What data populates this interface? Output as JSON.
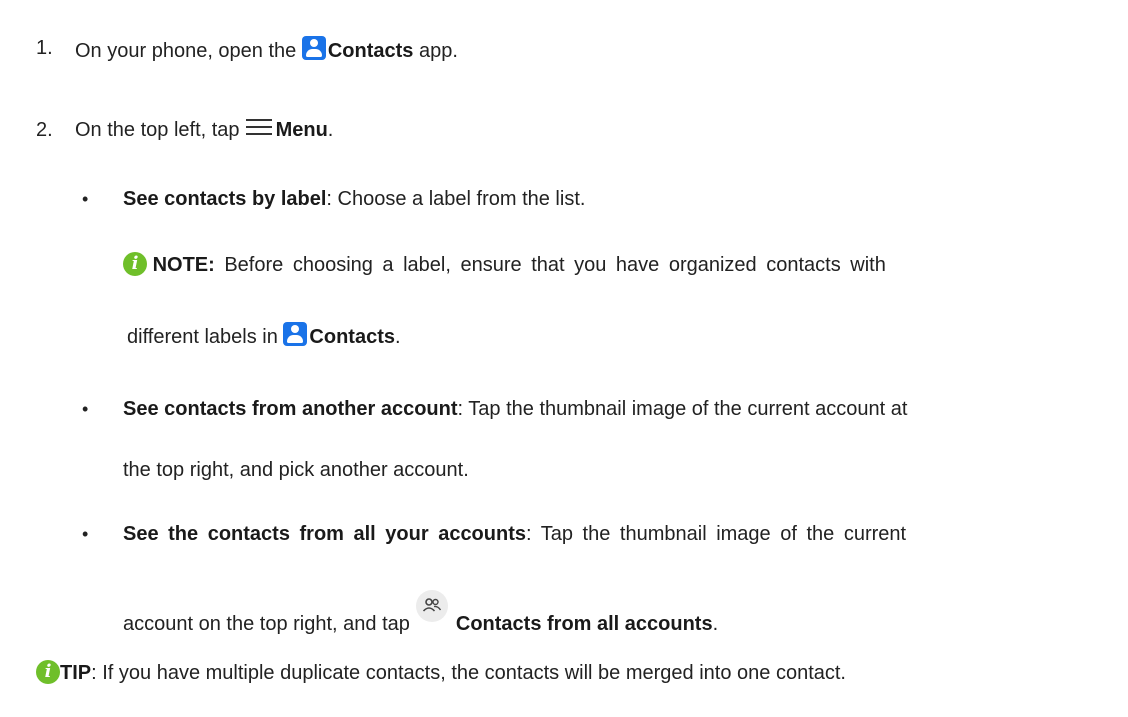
{
  "steps": [
    {
      "number": "1.",
      "text_before": "On your phone, open the",
      "app_name": "Contacts",
      "text_after": " app."
    },
    {
      "number": "2.",
      "text_before": "On the top left, tap",
      "bold": "Menu",
      "text_after": "."
    }
  ],
  "bullets": [
    {
      "title": "See contacts by label",
      "text": ": Choose a label from the list."
    },
    {
      "title": "See contacts from another account",
      "text_line1": ": Tap the thumbnail image of the current account at",
      "text_line2": "the top right, and pick another account."
    },
    {
      "title": "See the contacts from all your accounts",
      "text_line1": ": Tap the thumbnail image of the current",
      "text_line2": "account on the top right, and tap",
      "action": "Contacts from all accounts",
      "end": "."
    }
  ],
  "note": {
    "label": "NOTE:",
    "text_line1": " Before choosing a label, ensure that you have organized contacts with",
    "text_line2": "different labels in",
    "app_name": "Contacts",
    "end": "."
  },
  "tip": {
    "label": "TIP",
    "text": ": If you have multiple duplicate contacts, the contacts will be merged into one contact."
  },
  "icons": {
    "contacts_app": "contacts-app-icon",
    "menu": "menu-icon",
    "info": "info-icon",
    "contacts_all": "contacts-all-accounts-icon"
  },
  "colors": {
    "contacts_app_blue": "#1a73e8",
    "info_green": "#6fbf2a",
    "text": "#222222"
  }
}
